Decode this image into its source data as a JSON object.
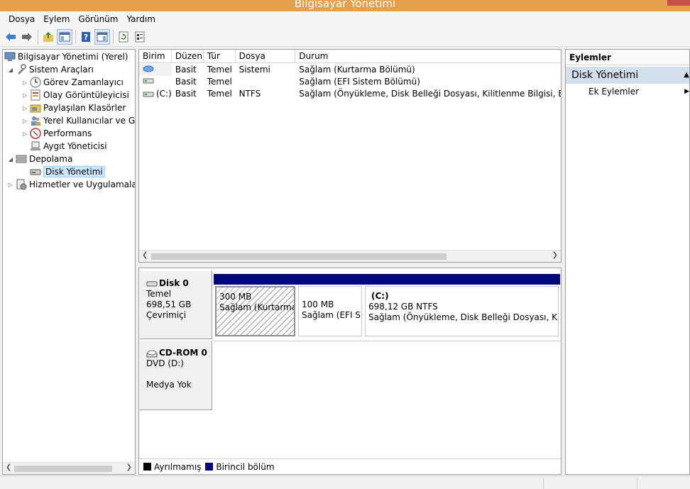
{
  "window": {
    "title": "Bilgisayar Yönetimi"
  },
  "menu": [
    "Dosya",
    "Eylem",
    "Görünüm",
    "Yardım"
  ],
  "toolbar": [
    "back-icon",
    "forward-icon",
    "up-folder-icon",
    "show-hide-tree-icon",
    "help-icon",
    "show-hide-action-pane-icon",
    "refresh-icon",
    "properties-icon"
  ],
  "tree": {
    "root": "Bilgisayar Yönetimi (Yerel)",
    "system_tools": "Sistem Araçları",
    "task_scheduler": "Görev Zamanlayıcı",
    "event_viewer": "Olay Görüntüleyicisi",
    "shared_folders": "Paylaşılan Klasörler",
    "local_users": "Yerel Kullanıcılar ve Gru",
    "performance": "Performans",
    "device_manager": "Aygıt Yöneticisi",
    "storage": "Depolama",
    "disk_management": "Disk Yönetimi",
    "services": "Hizmetler ve Uygulamalar"
  },
  "volumes": {
    "columns": [
      "Birim",
      "Düzen",
      "Tür",
      "Dosya Sistemi",
      "Durum"
    ],
    "rows": [
      {
        "volume": "",
        "layout": "Basit",
        "type": "Temel",
        "fs": "",
        "status": "Sağlam (Kurtarma Bölümü)"
      },
      {
        "volume": "",
        "layout": "Basit",
        "type": "Temel",
        "fs": "",
        "status": "Sağlam (EFI Sistem Bölümü)"
      },
      {
        "volume": "(C:)",
        "layout": "Basit",
        "type": "Temel",
        "fs": "NTFS",
        "status": "Sağlam (Önyükleme, Disk Belleği Dosyası, Kilitlenme Bilgisi, Birincil bö"
      }
    ]
  },
  "disks": {
    "disk0": {
      "name": "Disk 0",
      "type": "Temel",
      "size": "698,51 GB",
      "state": "Çevrimiçi",
      "partitions": [
        {
          "title": "",
          "size": "300 MB",
          "status": "Sağlam (Kurtarma B"
        },
        {
          "title": "",
          "size": "100 MB",
          "status": "Sağlam (EFI Sis"
        },
        {
          "title": "(C:)",
          "size": "698,12 GB NTFS",
          "status": "Sağlam (Önyükleme, Disk Belleği Dosyası, Kilitlenr"
        }
      ]
    },
    "cdrom0": {
      "name": "CD-ROM 0",
      "drive": "DVD (D:)",
      "media": "Medya Yok"
    }
  },
  "legend": {
    "unallocated": "Ayrılmamış",
    "primary": "Birincil bölüm",
    "unallocated_color": "#000000",
    "primary_color": "#00087e"
  },
  "actions": {
    "header": "Eylemler",
    "section": "Disk Yönetimi",
    "more": "Ek Eylemler"
  },
  "colors": {
    "title_bar": "#e4a04a",
    "selection": "#cce8ff",
    "partition_bar": "#00087e",
    "actions_section": "#d4dfee"
  }
}
